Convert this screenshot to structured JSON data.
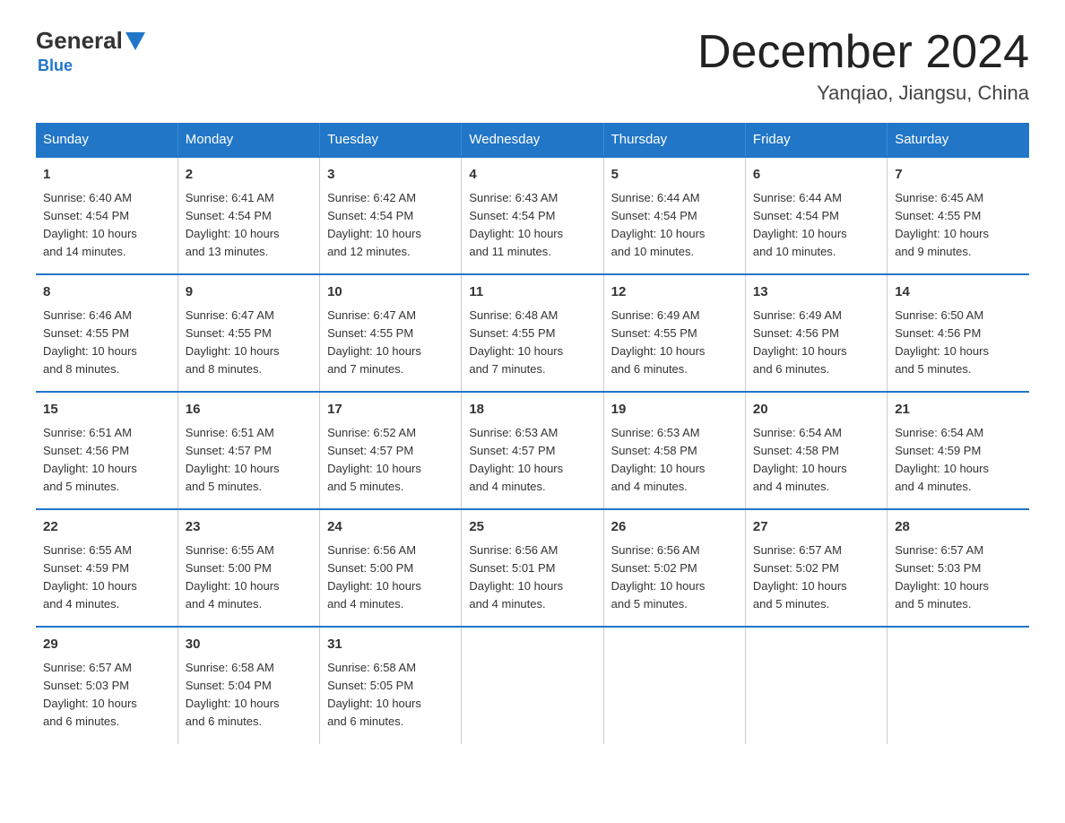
{
  "header": {
    "logo": {
      "general": "General",
      "triangle": "▶",
      "blue": "Blue"
    },
    "title": "December 2024",
    "location": "Yanqiao, Jiangsu, China"
  },
  "weekdays": [
    "Sunday",
    "Monday",
    "Tuesday",
    "Wednesday",
    "Thursday",
    "Friday",
    "Saturday"
  ],
  "weeks": [
    [
      {
        "day": "1",
        "sunrise": "6:40 AM",
        "sunset": "4:54 PM",
        "daylight": "10 hours and 14 minutes."
      },
      {
        "day": "2",
        "sunrise": "6:41 AM",
        "sunset": "4:54 PM",
        "daylight": "10 hours and 13 minutes."
      },
      {
        "day": "3",
        "sunrise": "6:42 AM",
        "sunset": "4:54 PM",
        "daylight": "10 hours and 12 minutes."
      },
      {
        "day": "4",
        "sunrise": "6:43 AM",
        "sunset": "4:54 PM",
        "daylight": "10 hours and 11 minutes."
      },
      {
        "day": "5",
        "sunrise": "6:44 AM",
        "sunset": "4:54 PM",
        "daylight": "10 hours and 10 minutes."
      },
      {
        "day": "6",
        "sunrise": "6:44 AM",
        "sunset": "4:54 PM",
        "daylight": "10 hours and 10 minutes."
      },
      {
        "day": "7",
        "sunrise": "6:45 AM",
        "sunset": "4:55 PM",
        "daylight": "10 hours and 9 minutes."
      }
    ],
    [
      {
        "day": "8",
        "sunrise": "6:46 AM",
        "sunset": "4:55 PM",
        "daylight": "10 hours and 8 minutes."
      },
      {
        "day": "9",
        "sunrise": "6:47 AM",
        "sunset": "4:55 PM",
        "daylight": "10 hours and 8 minutes."
      },
      {
        "day": "10",
        "sunrise": "6:47 AM",
        "sunset": "4:55 PM",
        "daylight": "10 hours and 7 minutes."
      },
      {
        "day": "11",
        "sunrise": "6:48 AM",
        "sunset": "4:55 PM",
        "daylight": "10 hours and 7 minutes."
      },
      {
        "day": "12",
        "sunrise": "6:49 AM",
        "sunset": "4:55 PM",
        "daylight": "10 hours and 6 minutes."
      },
      {
        "day": "13",
        "sunrise": "6:49 AM",
        "sunset": "4:56 PM",
        "daylight": "10 hours and 6 minutes."
      },
      {
        "day": "14",
        "sunrise": "6:50 AM",
        "sunset": "4:56 PM",
        "daylight": "10 hours and 5 minutes."
      }
    ],
    [
      {
        "day": "15",
        "sunrise": "6:51 AM",
        "sunset": "4:56 PM",
        "daylight": "10 hours and 5 minutes."
      },
      {
        "day": "16",
        "sunrise": "6:51 AM",
        "sunset": "4:57 PM",
        "daylight": "10 hours and 5 minutes."
      },
      {
        "day": "17",
        "sunrise": "6:52 AM",
        "sunset": "4:57 PM",
        "daylight": "10 hours and 5 minutes."
      },
      {
        "day": "18",
        "sunrise": "6:53 AM",
        "sunset": "4:57 PM",
        "daylight": "10 hours and 4 minutes."
      },
      {
        "day": "19",
        "sunrise": "6:53 AM",
        "sunset": "4:58 PM",
        "daylight": "10 hours and 4 minutes."
      },
      {
        "day": "20",
        "sunrise": "6:54 AM",
        "sunset": "4:58 PM",
        "daylight": "10 hours and 4 minutes."
      },
      {
        "day": "21",
        "sunrise": "6:54 AM",
        "sunset": "4:59 PM",
        "daylight": "10 hours and 4 minutes."
      }
    ],
    [
      {
        "day": "22",
        "sunrise": "6:55 AM",
        "sunset": "4:59 PM",
        "daylight": "10 hours and 4 minutes."
      },
      {
        "day": "23",
        "sunrise": "6:55 AM",
        "sunset": "5:00 PM",
        "daylight": "10 hours and 4 minutes."
      },
      {
        "day": "24",
        "sunrise": "6:56 AM",
        "sunset": "5:00 PM",
        "daylight": "10 hours and 4 minutes."
      },
      {
        "day": "25",
        "sunrise": "6:56 AM",
        "sunset": "5:01 PM",
        "daylight": "10 hours and 4 minutes."
      },
      {
        "day": "26",
        "sunrise": "6:56 AM",
        "sunset": "5:02 PM",
        "daylight": "10 hours and 5 minutes."
      },
      {
        "day": "27",
        "sunrise": "6:57 AM",
        "sunset": "5:02 PM",
        "daylight": "10 hours and 5 minutes."
      },
      {
        "day": "28",
        "sunrise": "6:57 AM",
        "sunset": "5:03 PM",
        "daylight": "10 hours and 5 minutes."
      }
    ],
    [
      {
        "day": "29",
        "sunrise": "6:57 AM",
        "sunset": "5:03 PM",
        "daylight": "10 hours and 6 minutes."
      },
      {
        "day": "30",
        "sunrise": "6:58 AM",
        "sunset": "5:04 PM",
        "daylight": "10 hours and 6 minutes."
      },
      {
        "day": "31",
        "sunrise": "6:58 AM",
        "sunset": "5:05 PM",
        "daylight": "10 hours and 6 minutes."
      },
      null,
      null,
      null,
      null
    ]
  ],
  "labels": {
    "sunrise": "Sunrise:",
    "sunset": "Sunset:",
    "daylight": "Daylight:"
  }
}
